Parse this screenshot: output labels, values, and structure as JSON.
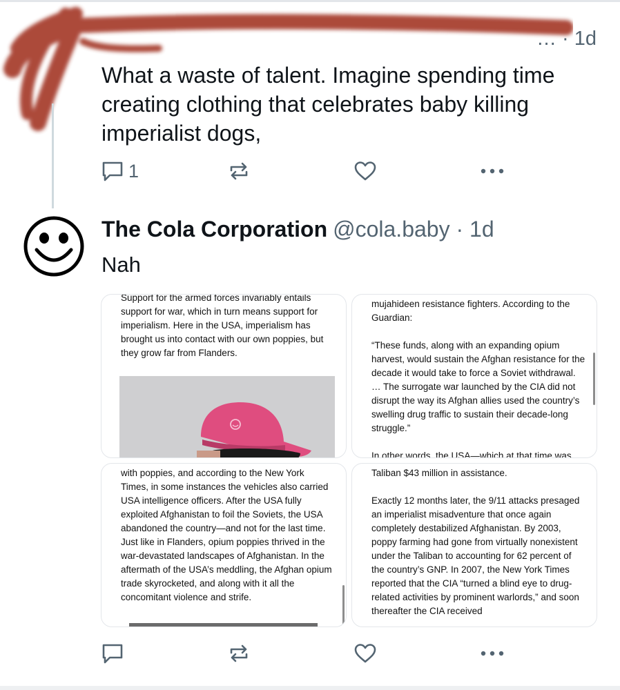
{
  "parent_post": {
    "handle_time": "… · 1d",
    "text": "What a waste of talent. Imagine spending time creating clothing that celebrates baby killing imperialist dogs,",
    "reply_count": "1"
  },
  "reply": {
    "author_name": "The Cola Corporation",
    "author_handle": "@cola.baby · 1d",
    "text": "Nah",
    "images": [
      {
        "paragraphs": [
          "Support for the armed forces invariably entails support for war, which in turn means support for imperialism. Here in the USA, imperialism has brought us into contact with our own poppies, but they grow far from Flanders."
        ]
      },
      {
        "paragraphs": [
          "mujahideen resistance fighters. According to the Guardian:",
          "“These funds, along with an expanding opium harvest, would sustain the Afghan resistance for the decade it would take to force a Soviet withdrawal. … The surrogate war launched by the CIA did not disrupt the way its Afghan allies used the country’s swelling drug traffic to sustain their decade-long struggle.”",
          "In other words, the USA—which at that time was"
        ]
      },
      {
        "paragraphs": [
          "with poppies, and according to the New York Times, in some instances the vehicles also carried USA intelligence officers. After the USA fully exploited Afghanistan to foil the Soviets, the USA abandoned the country—and not for the last time. Just like in Flanders, opium poppies thrived in the war-devastated landscapes of Afghanistan. In the aftermath of the USA’s meddling, the Afghan opium trade skyrocketed, and along with it all the concomitant violence and strife."
        ]
      },
      {
        "paragraphs": [
          "Taliban $43 million in assistance.",
          "Exactly 12 months later, the 9/11 attacks presaged an imperialist misadventure that once again completely destabilized Afghanistan. By 2003, poppy farming had gone from virtually nonexistent under the Taliban to accounting for 62 percent of the country’s GNP. In 2007, the New York Times reported that the CIA “turned a blind eye to drug-related activities by prominent warlords,” and soon thereafter the CIA received"
        ]
      }
    ]
  },
  "icons": {
    "reply": "speech-bubble-icon",
    "repost": "repost-arrows-icon",
    "like": "heart-icon",
    "more": "three-dots-icon",
    "avatar": "smiley-face-icon"
  },
  "colors": {
    "text": "#0f1419",
    "muted": "#536471",
    "redaction": "#a53a2c",
    "cap": "#e0497a"
  }
}
